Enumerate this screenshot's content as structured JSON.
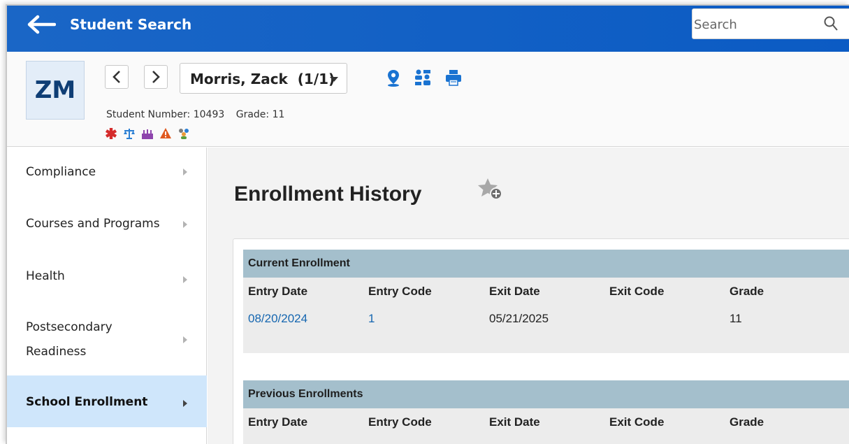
{
  "topbar": {
    "title": "Student Search",
    "search_placeholder": "Search",
    "back_icon": "back-arrow-icon",
    "color": "#0b5bc4"
  },
  "student": {
    "initials": "ZM",
    "name": "Morris, Zack",
    "position": "(1/1)",
    "name_display": "Morris, Zack  (1/1)",
    "student_number_text": "Student Number: 10493",
    "grade_text": "Grade: 11",
    "header_icons": [
      "map-pin-icon",
      "relationship-icon",
      "print-icon"
    ],
    "flag_icons": [
      "medical-icon",
      "legal-icon",
      "birthday-icon",
      "warning-icon",
      "group-icon"
    ]
  },
  "sidebar": {
    "items": [
      {
        "label": "Compliance",
        "active": false
      },
      {
        "label": "Courses and Programs",
        "active": false
      },
      {
        "label": "Health",
        "active": false
      },
      {
        "label": "Postsecondary Readiness",
        "active": false
      },
      {
        "label": "School Enrollment",
        "active": true
      }
    ]
  },
  "main": {
    "title": "Enrollment History",
    "favorite_icon": "star-add-icon",
    "current": {
      "heading": "Current Enrollment",
      "columns": [
        "Entry Date",
        "Entry Code",
        "Exit Date",
        "Exit Code",
        "Grade"
      ],
      "rows": [
        {
          "entry_date": "08/20/2024",
          "entry_code": "1",
          "exit_date": "05/21/2025",
          "exit_code": "",
          "grade": "11"
        }
      ]
    },
    "previous": {
      "heading": "Previous Enrollments",
      "columns": [
        "Entry Date",
        "Entry Code",
        "Exit Date",
        "Exit Code",
        "Grade"
      ]
    }
  },
  "colors": {
    "header_blue": "#0b5bc4",
    "section_header": "#a4bfcc",
    "active_nav": "#cfe6fb",
    "link": "#1566b0"
  }
}
